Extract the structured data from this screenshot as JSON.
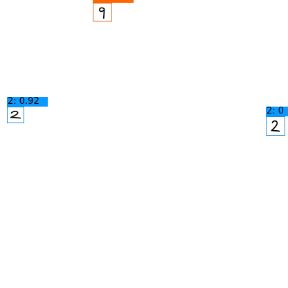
{
  "detections": [
    {
      "digit": "9",
      "label": "",
      "box_color": "#d2691e",
      "label_color": "#ff6600"
    },
    {
      "digit": "2",
      "label": "2: 0.92",
      "box_color": "#1e90d6",
      "label_color": "#0a99ff"
    },
    {
      "digit": "2",
      "label": "2: 0",
      "box_color": "#1e90d6",
      "label_color": "#0a99ff"
    }
  ]
}
